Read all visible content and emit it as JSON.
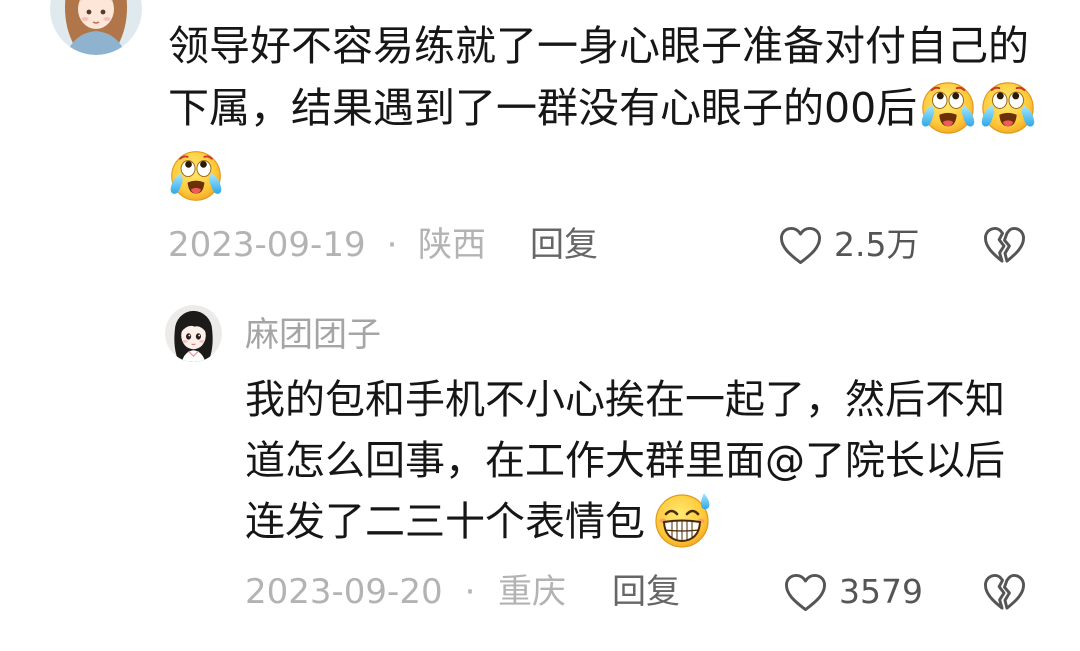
{
  "comment": {
    "avatar_icon": "user-avatar-girl-straw-hat",
    "lines": [
      {
        "text": "领导好不容易练就了一身心眼子准备对付自己的"
      },
      {
        "text": "下属，结果遇到了一群没有心眼子的00后",
        "emojis": [
          "crying-laughing-emoji",
          "crying-laughing-emoji"
        ]
      },
      {
        "emojis": [
          "crying-laughing-emoji"
        ]
      }
    ],
    "date": "2023-09-19",
    "separator": "·",
    "location": "陕西",
    "reply_label": "回复",
    "like_count": "2.5万",
    "like_icon": "heart-outline-icon",
    "dislike_icon": "broken-heart-icon"
  },
  "reply": {
    "username": "麻团团子",
    "avatar_icon": "user-avatar-girl-black-hair",
    "lines": [
      {
        "text": "我的包和手机不小心挨在一起了，然后不知"
      },
      {
        "text": "道怎么回事，在工作大群里面@了院长以后"
      },
      {
        "text": "连发了二三十个表情包",
        "emojis": [
          "grinning-sweat-emoji"
        ]
      }
    ],
    "date": "2023-09-20",
    "separator": "·",
    "location": "重庆",
    "reply_label": "回复",
    "like_count": "3579",
    "like_icon": "heart-outline-icon",
    "dislike_icon": "broken-heart-icon"
  },
  "colors": {
    "text": "#161616",
    "meta": "#b3b3b3",
    "reply_label": "#666666",
    "count": "#555555",
    "icon": "#555555",
    "username": "#a5a5a5"
  }
}
